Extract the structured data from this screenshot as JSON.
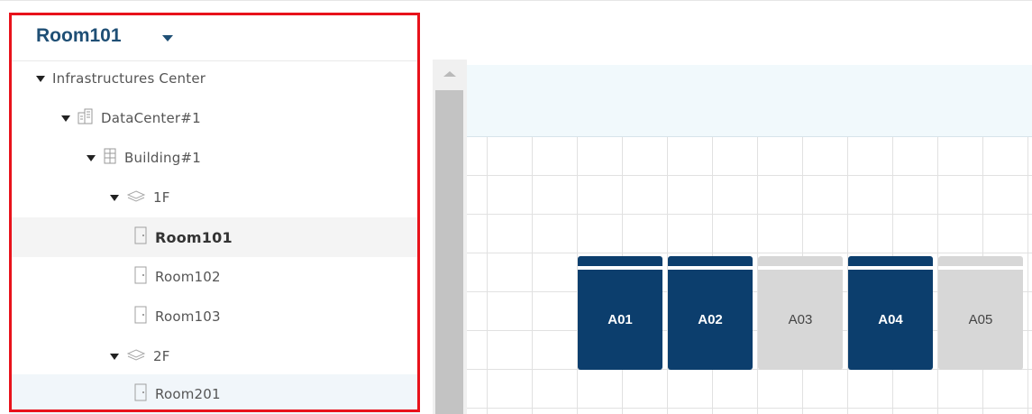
{
  "room_selector": {
    "value": "Room101"
  },
  "tree": [
    {
      "label": "Infrastructures Center",
      "type": "root",
      "expanded": true
    },
    {
      "label": "DataCenter#1",
      "type": "datacenter",
      "expanded": true
    },
    {
      "label": "Building#1",
      "type": "building",
      "expanded": true
    },
    {
      "label": "1F",
      "type": "floor",
      "expanded": true
    },
    {
      "label": "Room101",
      "type": "room",
      "selected": true
    },
    {
      "label": "Room102",
      "type": "room"
    },
    {
      "label": "Room103",
      "type": "room"
    },
    {
      "label": "2F",
      "type": "floor",
      "expanded": true
    },
    {
      "label": "Room201",
      "type": "room"
    }
  ],
  "racks": [
    {
      "label": "A01",
      "status": "active"
    },
    {
      "label": "A02",
      "status": "active"
    },
    {
      "label": "A03",
      "status": "inactive"
    },
    {
      "label": "A04",
      "status": "active"
    },
    {
      "label": "A05",
      "status": "inactive"
    }
  ],
  "colors": {
    "highlight": "#e8121b",
    "accent": "#1f4f75",
    "rack_active": "#0c3e6d",
    "rack_inactive": "#d7d7d7"
  }
}
